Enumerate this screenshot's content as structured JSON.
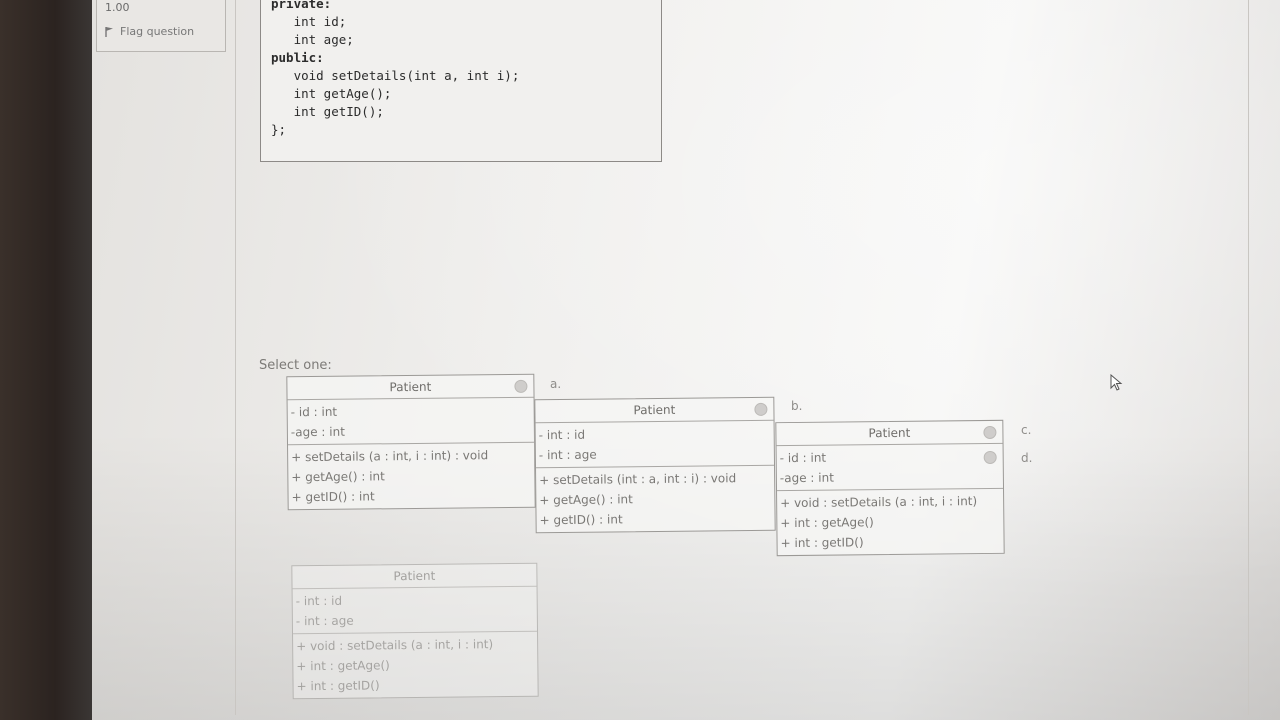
{
  "sidebar": {
    "mark_value": "1.00",
    "flag_label": "Flag question"
  },
  "code": {
    "lines": [
      {
        "text": "private:",
        "kw": true
      },
      {
        "text": "   int id;",
        "kw": false
      },
      {
        "text": "   int age;",
        "kw": false
      },
      {
        "text": "public:",
        "kw": true
      },
      {
        "text": "   void setDetails(int a, int i);",
        "kw": false
      },
      {
        "text": "   int getAge();",
        "kw": false
      },
      {
        "text": "   int getID();",
        "kw": false
      },
      {
        "text": "};",
        "kw": false
      }
    ]
  },
  "question": {
    "select_label": "Select one:"
  },
  "options": {
    "letters": [
      "a.",
      "b.",
      "c.",
      "d."
    ],
    "a": {
      "title": "Patient",
      "attributes": [
        "- id : int",
        "-age : int"
      ],
      "methods": [
        "+ setDetails (a : int, i : int) : void",
        "+ getAge() : int",
        "+ getID() : int"
      ]
    },
    "b": {
      "title": "Patient",
      "attributes": [
        "- int : id",
        "- int : age"
      ],
      "methods": [
        "+ setDetails (int : a, int : i) : void",
        "+ getAge() : int",
        "+ getID() : int"
      ]
    },
    "c": {
      "title": "Patient",
      "attributes": [
        "- id : int",
        "-age : int"
      ],
      "methods": [
        "+ void : setDetails (a : int, i : int)",
        "+ int : getAge()",
        "+ int : getID()"
      ]
    },
    "d": {
      "title": "Patient",
      "attributes": [
        "- int : id",
        "- int : age"
      ],
      "methods": [
        "+ void : setDetails (a : int, i : int)",
        "+ int : getAge()",
        "+ int : getID()"
      ]
    }
  },
  "colors": {
    "screen_bg": "#efeeec",
    "border": "#9b9996",
    "text": "#7a7875"
  }
}
